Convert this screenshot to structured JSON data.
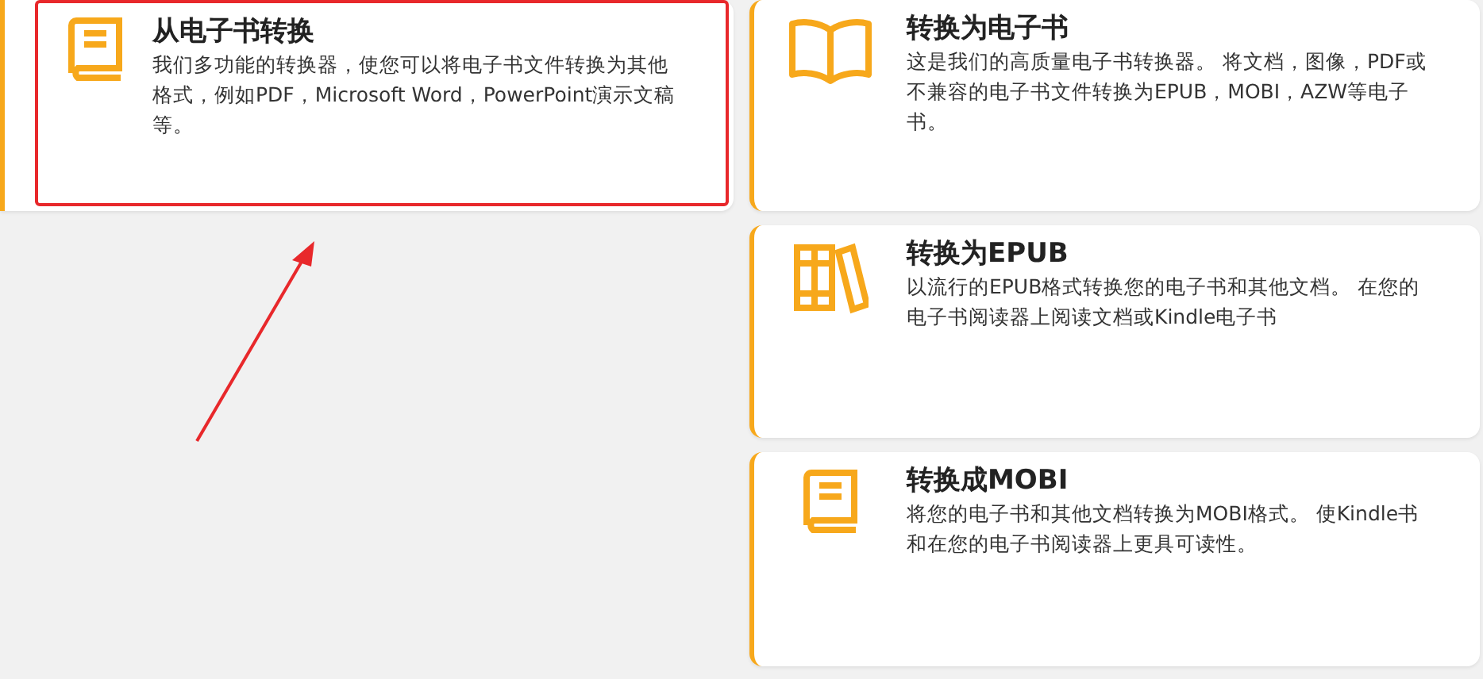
{
  "cards": [
    {
      "kind": "book",
      "title": "从电子书转换",
      "description": "我们多功能的转换器，使您可以将电子书文件转换为其他格式，例如PDF，Microsoft Word，PowerPoint演示文稿等。",
      "highlighted": true
    },
    {
      "kind": "open-book",
      "title": "转换为电子书",
      "description": "这是我们的高质量电子书转换器。 将文档，图像，PDF或不兼容的电子书文件转换为EPUB，MOBI，AZW等电子书。",
      "highlighted": false
    },
    {
      "kind": "books",
      "title": "转换为EPUB",
      "description": "以流行的EPUB格式转换您的电子书和其他文档。 在您的电子书阅读器上阅读文档或Kindle电子书",
      "highlighted": false
    },
    {
      "kind": "book",
      "title": "转换成MOBI",
      "description": "将您的电子书和其他文档转换为MOBI格式。 使Kindle书和在您的电子书阅读器上更具可读性。",
      "highlighted": false
    }
  ]
}
